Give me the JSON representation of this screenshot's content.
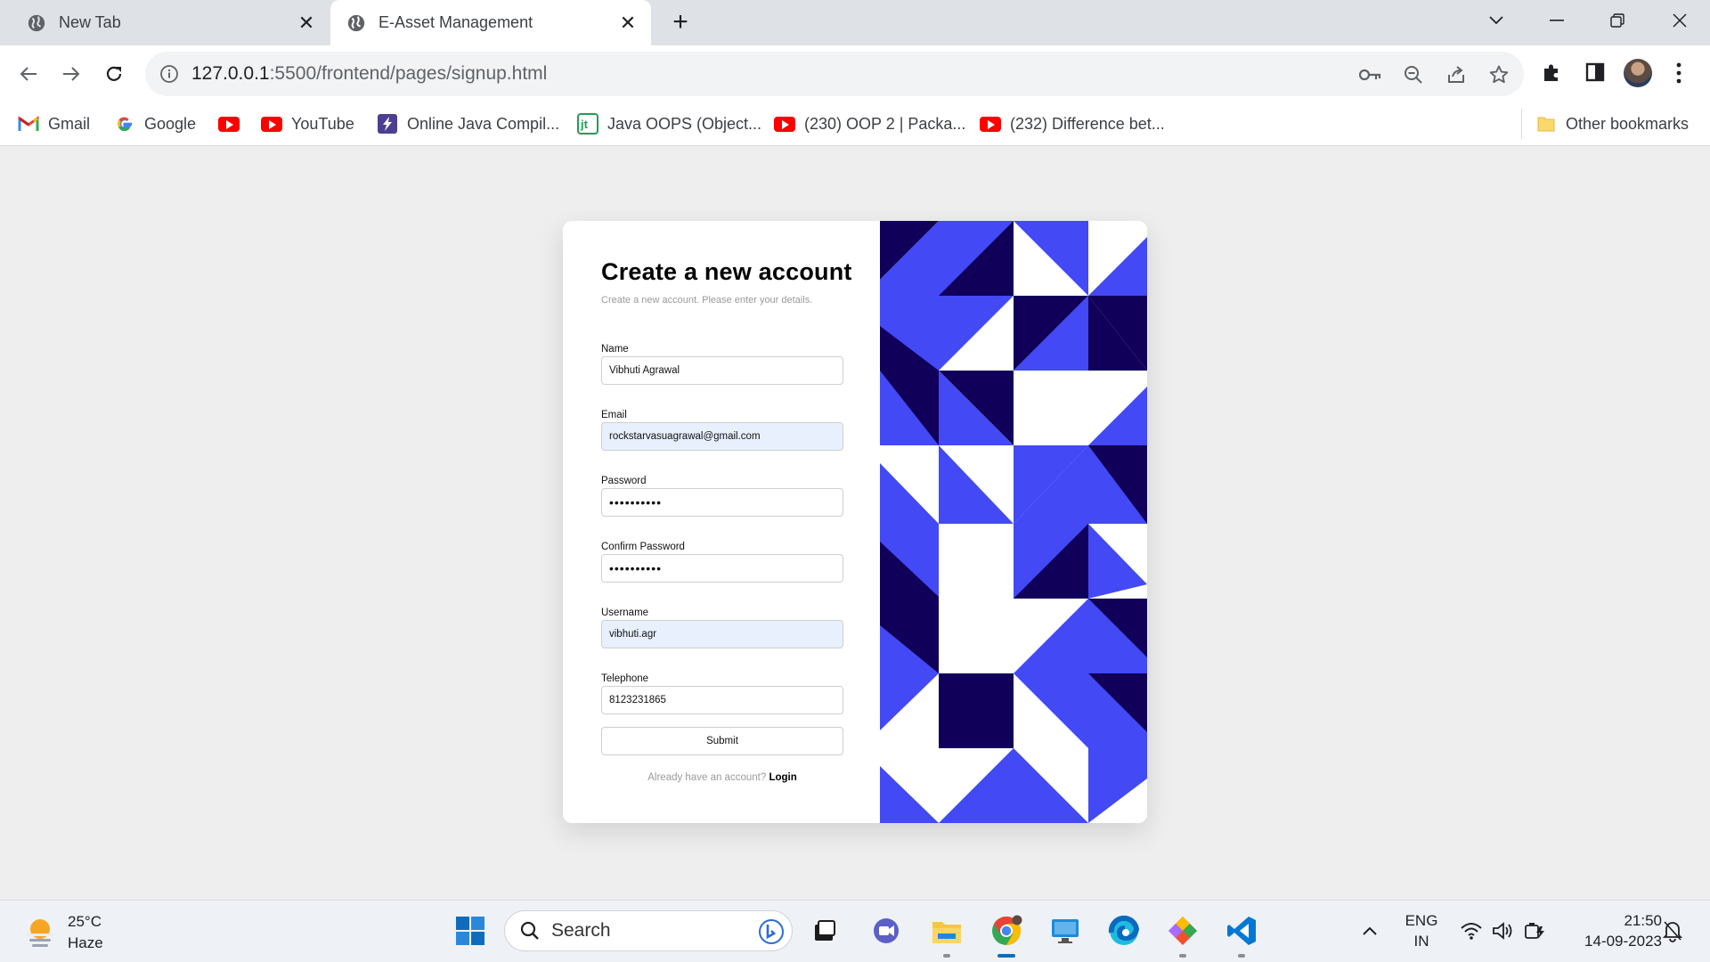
{
  "browser": {
    "tabs": [
      {
        "title": "New Tab",
        "active": false
      },
      {
        "title": "E-Asset Management",
        "active": true
      }
    ],
    "url_host": "127.0.0.1",
    "url_path": ":5500/frontend/pages/signup.html",
    "bookmarks": [
      {
        "label": "Gmail",
        "icon": "gmail-icon"
      },
      {
        "label": "Google",
        "icon": "google-icon"
      },
      {
        "label": "",
        "icon": "youtube-icon"
      },
      {
        "label": "YouTube",
        "icon": "youtube-icon"
      },
      {
        "label": "Online Java Compil...",
        "icon": "bolt-icon"
      },
      {
        "label": "Java OOPS (Object...",
        "icon": "javatpoint-icon"
      },
      {
        "label": "(230) OOP 2 | Packa...",
        "icon": "youtube-icon"
      },
      {
        "label": "(232) Difference bet...",
        "icon": "youtube-icon"
      }
    ],
    "other_bookmarks": "Other bookmarks"
  },
  "signup": {
    "title": "Create a new account",
    "subtitle": "Create a new account. Please enter your details.",
    "fields": {
      "name": {
        "label": "Name",
        "value": "Vibhuti Agrawal"
      },
      "email": {
        "label": "Email",
        "value": "rockstarvasuagrawal@gmail.com"
      },
      "password": {
        "label": "Password",
        "value": "••••••••••"
      },
      "confirm": {
        "label": "Confirm Password",
        "value": "••••••••••"
      },
      "username": {
        "label": "Username",
        "value": "vibhuti.agr"
      },
      "telephone": {
        "label": "Telephone",
        "value": "8123231865"
      }
    },
    "submit_label": "Submit",
    "login_prompt": "Already have an account?",
    "login_link": "Login"
  },
  "colors": {
    "art_light": "#4249f5",
    "art_dark": "#11005a",
    "page_bg": "#eeeeee"
  },
  "taskbar": {
    "weather_temp": "25°C",
    "weather_desc": "Haze",
    "search_label": "Search",
    "lang_line1": "ENG",
    "lang_line2": "IN",
    "time": "21:50",
    "date": "14-09-2023"
  }
}
